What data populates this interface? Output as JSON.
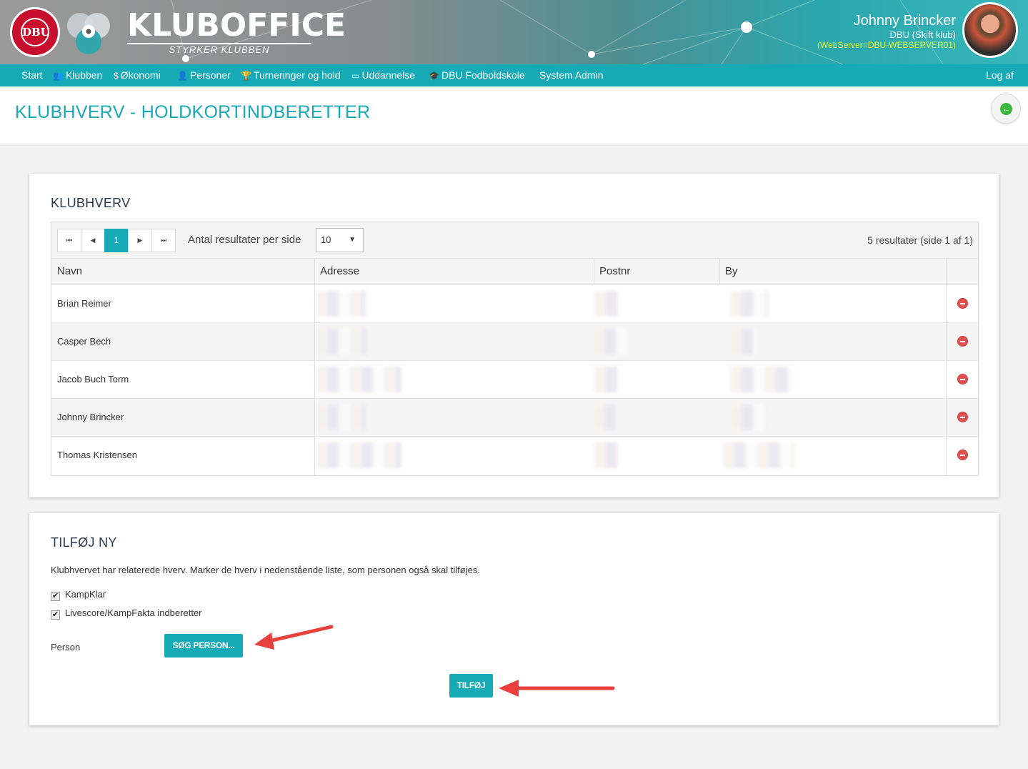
{
  "header": {
    "brand_name": "KLUBOFFICE",
    "brand_tagline": "STYRKER KLUBBEN",
    "dbu_badge": "DBU",
    "user_name": "Johnny Brincker",
    "club_line": "DBU (Skift klub)",
    "server_line": "(WebServer=DBU-WEBSERVER01)"
  },
  "nav": {
    "items": [
      {
        "label": "Start",
        "icon": ""
      },
      {
        "label": "Klubben",
        "icon": "people-icon"
      },
      {
        "label": "Økonomi",
        "icon": "money-icon"
      },
      {
        "label": "Personer",
        "icon": "person-icon"
      },
      {
        "label": "Turneringer og hold",
        "icon": "trophy-icon"
      },
      {
        "label": "Uddannelse",
        "icon": "presentation-icon"
      },
      {
        "label": "DBU Fodboldskole",
        "icon": "graduation-cap-icon"
      },
      {
        "label": "System Admin",
        "icon": ""
      }
    ],
    "logout": "Log af"
  },
  "page": {
    "title": "KLUBHVERV - HOLDKORTINDBERETTER"
  },
  "klubhverv": {
    "title": "KLUBHVERV",
    "pager": {
      "first": "⏮",
      "prev": "◀",
      "current": "1",
      "next": "▶",
      "last": "⏭",
      "per_page_label": "Antal resultater per side",
      "per_page_value": "10",
      "results_text": "5 resultater (side 1 af 1)"
    },
    "columns": [
      "Navn",
      "Adresse",
      "Postnr",
      "By"
    ],
    "rows": [
      {
        "name": "Brian Reimer"
      },
      {
        "name": "Casper Bech"
      },
      {
        "name": "Jacob Buch Torm"
      },
      {
        "name": "Johnny Brincker"
      },
      {
        "name": "Thomas Kristensen"
      }
    ]
  },
  "add_new": {
    "title": "TILFØJ NY",
    "description": "Klubhvervet har relaterede hverv. Marker de hverv i nedenstående liste, som personen også skal tilføjes.",
    "checkboxes": [
      {
        "label": "KampKlar",
        "checked": true
      },
      {
        "label": "Livescore/KampFakta indberetter",
        "checked": true
      }
    ],
    "person_label": "Person",
    "search_button": "SØG PERSON...",
    "add_button": "TILFØJ"
  },
  "colors": {
    "accent": "#16aab6",
    "title": "#17a9b5",
    "delete": "#e0504c",
    "annotation_arrow": "#e8413d"
  }
}
